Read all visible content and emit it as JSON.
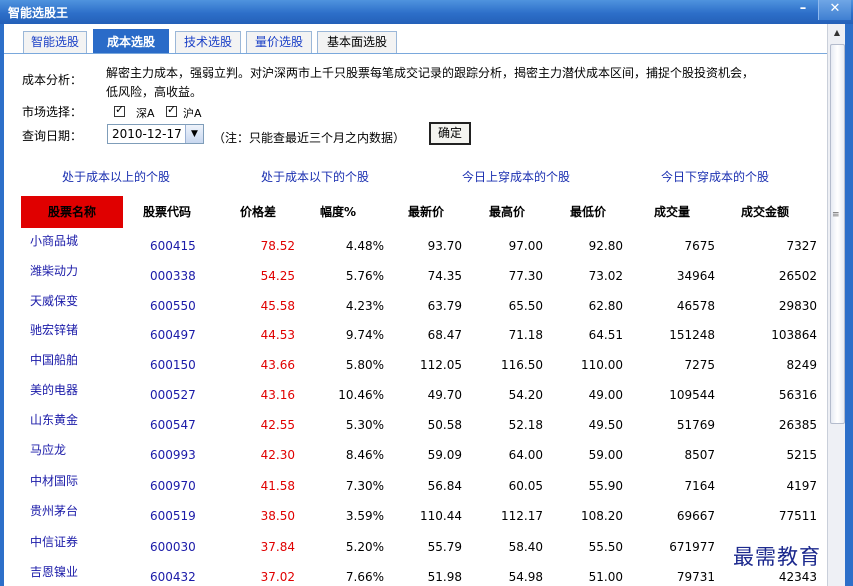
{
  "window": {
    "title": "智能选股王",
    "min": "–",
    "close": "✕"
  },
  "tabs": [
    "智能选股",
    "成本选股",
    "技术选股",
    "量价选股",
    "基本面选股"
  ],
  "analysis": {
    "label": "成本分析：",
    "line1": "解密主力成本，强弱立判。对沪深两市上千只股票每笔成交记录的跟踪分析，揭密主力潜伏成本区间，捕捉个股投资机会，",
    "line2": "低风险，高收益。"
  },
  "market": {
    "label": "市场选择：",
    "opt1": "深A",
    "opt2": "沪A"
  },
  "date": {
    "label": "查询日期：",
    "value": "2010-12-17",
    "note": "（注：只能查最近三个月之内数据）",
    "ok": "确定"
  },
  "categories": [
    "处于成本以上的个股",
    "处于成本以下的个股",
    "今日上穿成本的个股",
    "今日下穿成本的个股"
  ],
  "table": {
    "headers": [
      "股票名称",
      "股票代码",
      "价格差",
      "幅度%",
      "最新价",
      "最高价",
      "最低价",
      "成交量",
      "成交金额"
    ],
    "rows": [
      [
        "小商品城",
        "600415",
        "78.52",
        "4.48%",
        "93.70",
        "97.00",
        "92.80",
        "7675",
        "7327"
      ],
      [
        "潍柴动力",
        "000338",
        "54.25",
        "5.76%",
        "74.35",
        "77.30",
        "73.02",
        "34964",
        "26502"
      ],
      [
        "天威保变",
        "600550",
        "45.58",
        "4.23%",
        "63.79",
        "65.50",
        "62.80",
        "46578",
        "29830"
      ],
      [
        "驰宏锌锗",
        "600497",
        "44.53",
        "9.74%",
        "68.47",
        "71.18",
        "64.51",
        "151248",
        "103864"
      ],
      [
        "中国船舶",
        "600150",
        "43.66",
        "5.80%",
        "112.05",
        "116.50",
        "110.00",
        "7275",
        "8249"
      ],
      [
        "美的电器",
        "000527",
        "43.16",
        "10.46%",
        "49.70",
        "54.20",
        "49.00",
        "109544",
        "56316"
      ],
      [
        "山东黄金",
        "600547",
        "42.55",
        "5.30%",
        "50.58",
        "52.18",
        "49.50",
        "51769",
        "26385"
      ],
      [
        "马应龙",
        "600993",
        "42.30",
        "8.46%",
        "59.09",
        "64.00",
        "59.00",
        "8507",
        "5215"
      ],
      [
        "中材国际",
        "600970",
        "41.58",
        "7.30%",
        "56.84",
        "60.05",
        "55.90",
        "7164",
        "4197"
      ],
      [
        "贵州茅台",
        "600519",
        "38.50",
        "3.59%",
        "110.44",
        "112.17",
        "108.20",
        "69667",
        "77511"
      ],
      [
        "中信证券",
        "600030",
        "37.84",
        "5.20%",
        "55.79",
        "58.40",
        "55.50",
        "671977",
        ""
      ],
      [
        "吉恩镍业",
        "600432",
        "37.02",
        "7.66%",
        "51.98",
        "54.98",
        "51.00",
        "79731",
        "42343"
      ]
    ]
  },
  "watermark": "最需教育",
  "scrollbar": {
    "up": "▲",
    "grip": "≡"
  }
}
